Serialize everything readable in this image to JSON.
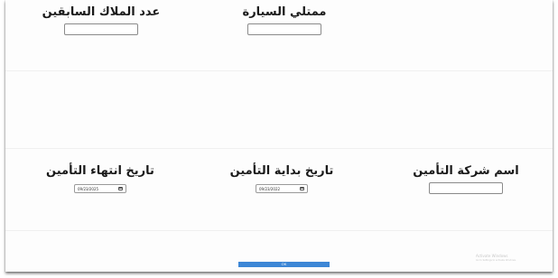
{
  "form": {
    "previous_owners": {
      "label": "عدد الملاك السابقين",
      "value": ""
    },
    "car_owner": {
      "label": "ممتلي السيارة",
      "value": ""
    },
    "insurance_end_date": {
      "label": "تاريخ انتهاء التأمين",
      "value": "09/23/2025"
    },
    "insurance_start_date": {
      "label": "تاريخ بداية التأمين",
      "value": "09/23/2022"
    },
    "insurance_company": {
      "label": "اسم شركة التأمين",
      "value": ""
    },
    "ok_label": "OK"
  },
  "watermark": {
    "title": "Activate Windows",
    "subtitle": "Go to Settings to activate Windows."
  },
  "colors": {
    "button": "#3d87d6",
    "background": "#ffffff",
    "label_text": "#1a1a1a"
  },
  "icons": {
    "date_picker": "calendar-icon"
  }
}
